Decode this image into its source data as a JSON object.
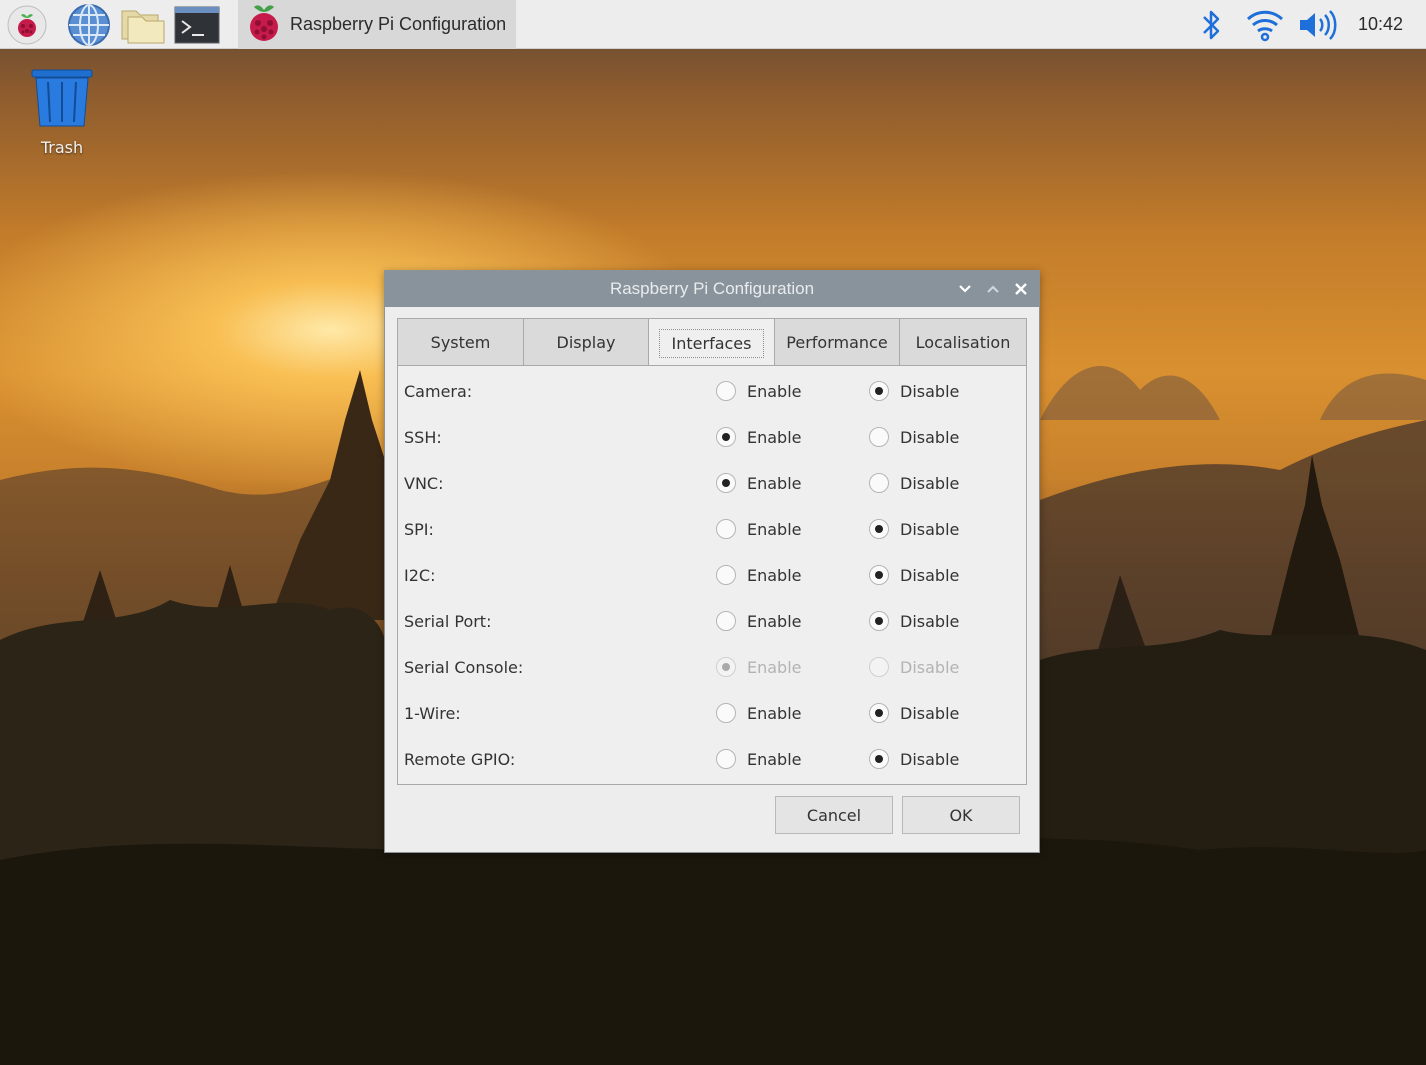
{
  "taskbar": {
    "launchers": [
      {
        "name": "raspberry-menu-icon"
      },
      {
        "name": "web-browser-icon"
      },
      {
        "name": "file-manager-icon"
      },
      {
        "name": "terminal-icon"
      }
    ],
    "task_label": "Raspberry Pi Configuration",
    "tray": [
      "bluetooth-icon",
      "wifi-icon",
      "volume-icon"
    ],
    "clock": "10:42"
  },
  "desktop": {
    "trash_label": "Trash"
  },
  "dialog": {
    "title": "Raspberry Pi Configuration",
    "tabs": [
      "System",
      "Display",
      "Interfaces",
      "Performance",
      "Localisation"
    ],
    "active_tab": "Interfaces",
    "enable_label": "Enable",
    "disable_label": "Disable",
    "rows": [
      {
        "label": "Camera:",
        "value": "Disable",
        "disabled": false
      },
      {
        "label": "SSH:",
        "value": "Enable",
        "disabled": false
      },
      {
        "label": "VNC:",
        "value": "Enable",
        "disabled": false
      },
      {
        "label": "SPI:",
        "value": "Disable",
        "disabled": false
      },
      {
        "label": "I2C:",
        "value": "Disable",
        "disabled": false
      },
      {
        "label": "Serial Port:",
        "value": "Disable",
        "disabled": false
      },
      {
        "label": "Serial Console:",
        "value": "Enable",
        "disabled": true
      },
      {
        "label": "1-Wire:",
        "value": "Disable",
        "disabled": false
      },
      {
        "label": "Remote GPIO:",
        "value": "Disable",
        "disabled": false
      }
    ],
    "cancel_label": "Cancel",
    "ok_label": "OK"
  }
}
